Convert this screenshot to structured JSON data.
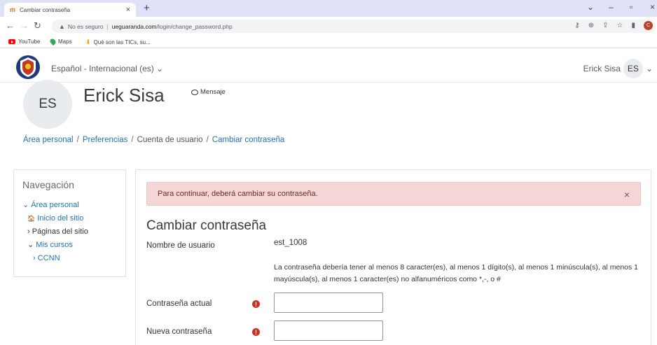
{
  "browser": {
    "tab_title": "Cambiar contraseña",
    "security_label": "No es seguro",
    "url_host": "ueguaranda.com",
    "url_path": "/login/change_password.php",
    "profile_initial": "C",
    "bookmarks": [
      {
        "label": "YouTube",
        "icon": "youtube-icon"
      },
      {
        "label": "Maps",
        "icon": "maps-icon"
      },
      {
        "label": "Qué son las TICs, su...",
        "icon": "download-icon"
      }
    ]
  },
  "navbar": {
    "language": "Español - Internacional (es) ⌄",
    "user_name": "Erick Sisa",
    "user_initials": "ES"
  },
  "header": {
    "avatar_initials": "ES",
    "full_name": "Erick Sisa",
    "message_label": "Mensaje"
  },
  "breadcrumb": [
    {
      "label": "Área personal",
      "link": true
    },
    {
      "label": "Preferencias",
      "link": true
    },
    {
      "label": "Cuenta de usuario",
      "link": false
    },
    {
      "label": "Cambiar contraseña",
      "link": true
    }
  ],
  "navigation": {
    "title": "Navegación",
    "items": [
      {
        "label": "Área personal",
        "prefix": "⌄"
      },
      {
        "label": "Inicio del sitio",
        "prefix": "🏠"
      },
      {
        "label": "Páginas del sitio",
        "prefix": "›"
      },
      {
        "label": "Mis cursos",
        "prefix": "⌄"
      },
      {
        "label": "CCNN",
        "prefix": "›"
      }
    ]
  },
  "main": {
    "alert": "Para continuar, deberá cambiar su contraseña.",
    "form_title": "Cambiar contraseña",
    "username_label": "Nombre de usuario",
    "username_value": "est_1008",
    "password_hint": "La contraseña debería tener al menos 8 caracter(es), al menos 1 dígito(s), al menos 1 minúscula(s), al menos 1 mayúscula(s), al menos 1 caracter(es) no alfanuméricos como *,-, o #",
    "current_password_label": "Contraseña actual",
    "new_password_label": "Nueva contraseña"
  }
}
